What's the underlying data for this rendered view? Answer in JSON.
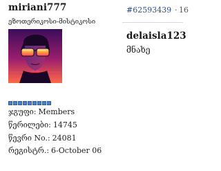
{
  "poster": {
    "username": "miriani777",
    "user_title": "ეზოთერიკოსი-მისტიკოსი",
    "avatar": "avatar-image",
    "rank_pips": 9,
    "stats": {
      "group_label": "ჯგუფი:",
      "group_value": "Members",
      "posts_label": "წერილები:",
      "posts_value": "14745",
      "member_no_label": "წევრი No.:",
      "member_no_value": "24081",
      "registered_label": "რეგისტრ.:",
      "registered_value": "6-October 06"
    }
  },
  "post": {
    "number": "#62593439",
    "separator": "·",
    "date_fragment": "16",
    "quote_author": "delaisla123",
    "body": "მნახე"
  },
  "colors": {
    "link": "#2b4e8c",
    "rank_pip": "#4f7ec4"
  }
}
